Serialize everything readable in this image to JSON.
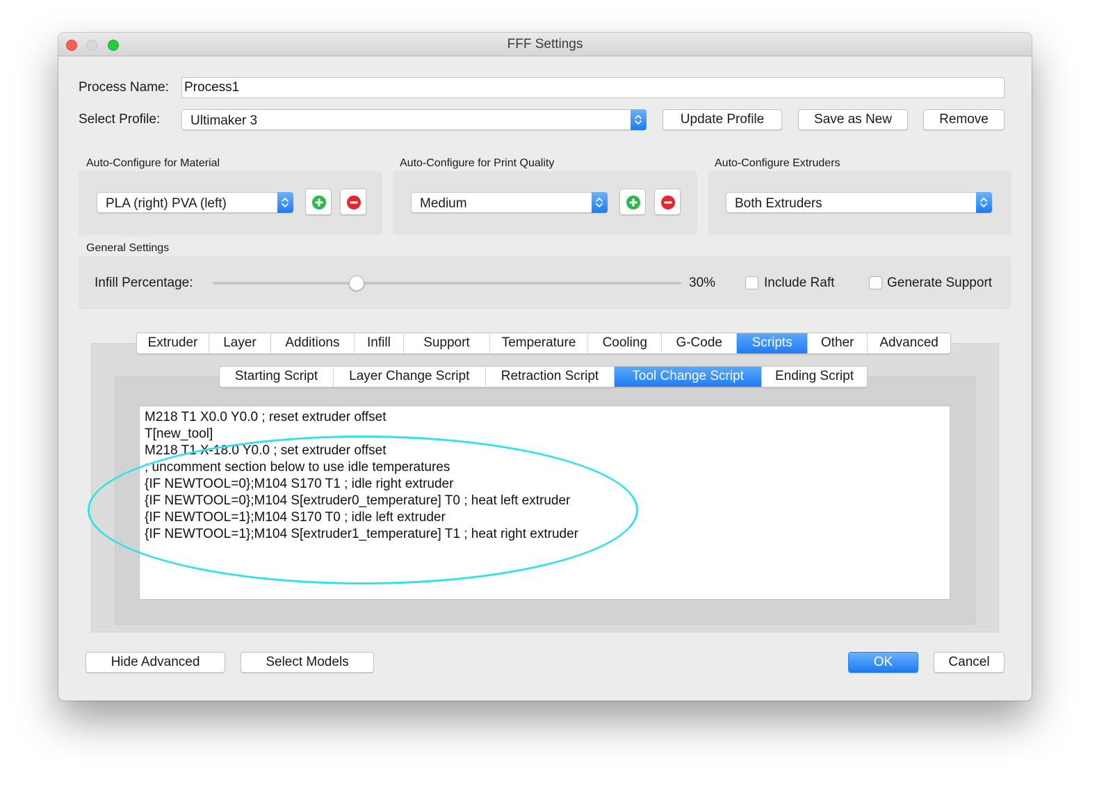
{
  "window": {
    "title": "FFF Settings"
  },
  "process": {
    "label": "Process Name:",
    "value": "Process1"
  },
  "profile": {
    "label": "Select Profile:",
    "selected": "Ultimaker 3",
    "update_label": "Update Profile",
    "save_new_label": "Save as New",
    "remove_label": "Remove"
  },
  "auto_material": {
    "title": "Auto-Configure for Material",
    "selected": "PLA (right) PVA (left)"
  },
  "auto_quality": {
    "title": "Auto-Configure for Print Quality",
    "selected": "Medium"
  },
  "auto_extruders": {
    "title": "Auto-Configure Extruders",
    "selected": "Both Extruders"
  },
  "general": {
    "title": "General Settings",
    "infill_label": "Infill Percentage:",
    "infill_value_text": "30%",
    "infill_fraction": 0.3,
    "include_raft_label": "Include Raft",
    "include_raft_checked": false,
    "generate_support_label": "Generate Support",
    "generate_support_checked": false
  },
  "tabs": {
    "items": [
      "Extruder",
      "Layer",
      "Additions",
      "Infill",
      "Support",
      "Temperature",
      "Cooling",
      "G-Code",
      "Scripts",
      "Other",
      "Advanced"
    ],
    "active": "Scripts"
  },
  "subtabs": {
    "items": [
      "Starting Script",
      "Layer Change Script",
      "Retraction Script",
      "Tool Change Script",
      "Ending Script"
    ],
    "active": "Tool Change Script"
  },
  "script_lines": [
    "M218 T1 X0.0 Y0.0 ; reset extruder offset",
    "T[new_tool]",
    "M218 T1 X-18.0 Y0.0 ; set extruder offset",
    "; uncomment section below to use idle temperatures",
    "{IF NEWTOOL=0};M104 S170 T1 ; idle right extruder",
    "{IF NEWTOOL=0};M104 S[extruder0_temperature] T0 ; heat left extruder",
    "{IF NEWTOOL=1};M104 S170 T0 ; idle left extruder",
    "{IF NEWTOOL=1};M104 S[extruder1_temperature] T1 ; heat right extruder"
  ],
  "footer": {
    "hide_advanced_label": "Hide Advanced",
    "select_models_label": "Select Models",
    "ok_label": "OK",
    "cancel_label": "Cancel"
  },
  "colors": {
    "accent": "#1f7cf3",
    "highlight_annotation": "#2fe3ea",
    "add_green": "#2db84a",
    "remove_red": "#e8242c"
  }
}
